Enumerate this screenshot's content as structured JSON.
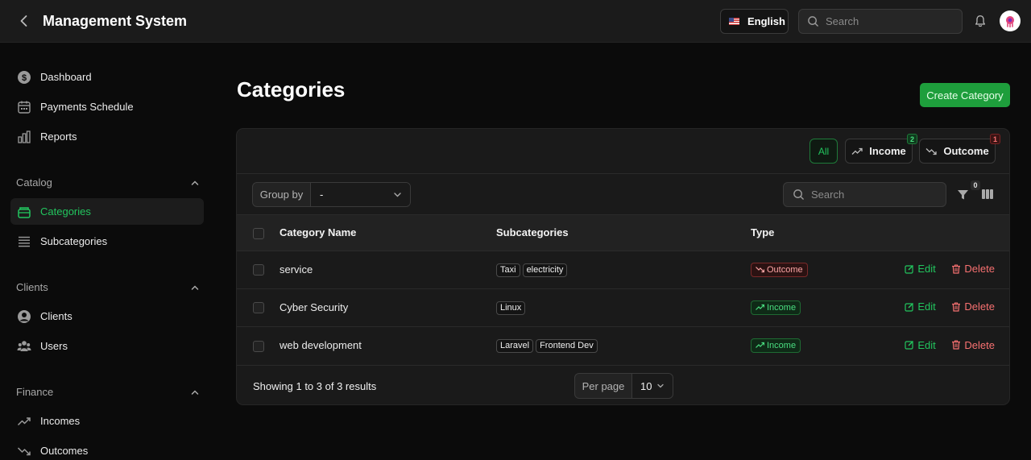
{
  "header": {
    "title": "Management System",
    "language": "English",
    "search_placeholder": "Search"
  },
  "sidebar": {
    "items_top": [
      {
        "label": "Dashboard",
        "icon": "dollar-circle-icon"
      },
      {
        "label": "Payments Schedule",
        "icon": "calendar-icon"
      },
      {
        "label": "Reports",
        "icon": "bar-chart-icon"
      }
    ],
    "groups": [
      {
        "label": "Catalog",
        "items": [
          {
            "label": "Categories",
            "icon": "folder-icon",
            "active": true
          },
          {
            "label": "Subcategories",
            "icon": "list-icon"
          }
        ]
      },
      {
        "label": "Clients",
        "items": [
          {
            "label": "Clients",
            "icon": "user-circle-icon"
          },
          {
            "label": "Users",
            "icon": "users-icon"
          }
        ]
      },
      {
        "label": "Finance",
        "items": [
          {
            "label": "Incomes",
            "icon": "trend-up-icon"
          },
          {
            "label": "Outcomes",
            "icon": "trend-down-icon"
          }
        ]
      }
    ]
  },
  "main": {
    "title": "Categories",
    "create_label": "Create Category",
    "tabs": [
      {
        "label": "All",
        "count": ""
      },
      {
        "label": "Income",
        "count": "2"
      },
      {
        "label": "Outcome",
        "count": "1"
      }
    ],
    "group_by_label": "Group by",
    "group_by_value": "-",
    "search_placeholder": "Search",
    "filter_count": "0",
    "columns": [
      "Category Name",
      "Subcategories",
      "Type"
    ],
    "rows": [
      {
        "name": "service",
        "subcategories": [
          "Taxi",
          "electricity"
        ],
        "type": "Outcome"
      },
      {
        "name": "Cyber Security",
        "subcategories": [
          "Linux"
        ],
        "type": "Income"
      },
      {
        "name": "web development",
        "subcategories": [
          "Laravel",
          "Frontend Dev"
        ],
        "type": "Income"
      }
    ],
    "edit_label": "Edit",
    "delete_label": "Delete",
    "results_text": "Showing 1 to 3 of 3 results",
    "per_page_label": "Per page",
    "per_page_value": "10"
  },
  "colors": {
    "accent": "#22c55e",
    "danger": "#f87171",
    "primary_button": "#1e9e3c"
  }
}
